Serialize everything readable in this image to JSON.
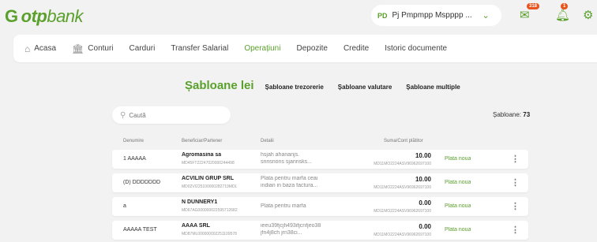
{
  "brand": {
    "logo_prefix": "G",
    "logo_bold": "otp",
    "logo_light": "bank"
  },
  "header": {
    "profile_initials": "PD",
    "profile_name": "Pj Pmpmpp Mspppp ...",
    "messages_badge": "318",
    "notifications_badge": "1",
    "icons": [
      "mail-icon",
      "bell-icon",
      "settings-icon"
    ]
  },
  "nav": {
    "home": "Acasa",
    "accounts": "Conturi",
    "cards": "Carduri",
    "salary": "Transfer Salarial",
    "operations": "Operațiuni",
    "deposits": "Depozite",
    "credits": "Credite",
    "history": "Istoric documente"
  },
  "subnav": {
    "lei": "Șabloane lei",
    "treasury": "Șabloane trezorerie",
    "currency": "Șabloane valutare",
    "multiple": "Șabloane multiple"
  },
  "search": {
    "placeholder": "Caută"
  },
  "templates_count": {
    "label": "Șabloane:",
    "value": "73"
  },
  "table": {
    "columns": {
      "name": "Denumire",
      "beneficiary": "Beneficiar/Partener",
      "details": "Detalii",
      "amount": "Suma/Cont plătitor"
    },
    "rows": [
      {
        "name": "1 AAAAA",
        "beneficiary": "Agromasina sa",
        "beneficiary_account": "MD45FT22247020000244498",
        "details_line1": "hsjah ahananjs.",
        "details_line2": "snnsnons sjannsks...",
        "amount": "10.00",
        "payer_account": "MD11MO2224ASV96962697100",
        "action": "Plata noua"
      },
      {
        "name": "(D) DDDDDDD",
        "beneficiary": "ACVILIN GRUP SRL",
        "beneficiary_account": "MD02VI225100000282719MDL",
        "details_line1": "Plata pentru marfa ceai",
        "details_line2": "indian in baza factura...",
        "amount": "10.00",
        "payer_account": "MD11MO2224ASV96962697100",
        "action": "Plata noua"
      },
      {
        "name": "a",
        "beneficiary": "N DUNNERY1",
        "beneficiary_account": "MD67AG000000022595712682",
        "details_line1": "Plata pentru marfa",
        "details_line2": "",
        "amount": "0.00",
        "payer_account": "MD11MO2224ASV96962697100",
        "action": "Plata noua"
      },
      {
        "name": "AAAAA TEST",
        "beneficiary": "AAAA SRL",
        "beneficiary_account": "MD87ML000000002251109578",
        "details_line1": "ieeu39fjcjfi493ifjcnfjeo38",
        "details_line2": "jfn4j8ch jrn38ci...",
        "amount": "0.00",
        "payer_account": "MD11MO2224ASV96962697100",
        "action": "Plata noua"
      }
    ]
  },
  "colors": {
    "accent": "#5aa02c",
    "badge": "#e8541e",
    "background": "#f2f2f2"
  }
}
